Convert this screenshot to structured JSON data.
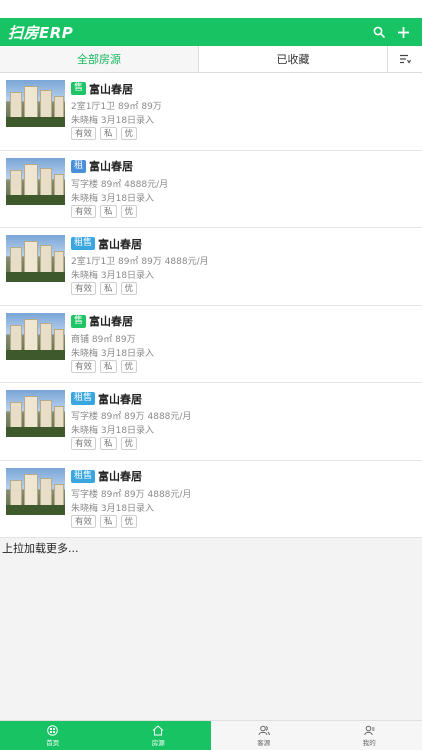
{
  "app": {
    "brand": "扫房ERP"
  },
  "colors": {
    "primary": "#18c364",
    "sale_badge": "#1fc465",
    "rent_badge": "#4a90d9",
    "salerent_badge": "#3aa6e0"
  },
  "tabs": [
    {
      "label": "全部房源",
      "active": true
    },
    {
      "label": "已收藏",
      "active": false
    }
  ],
  "listings": [
    {
      "badge": "售",
      "badge_type": "sale",
      "name": "富山春居",
      "detail": "2室1厅1卫   89㎡   89万",
      "agent": "朱晓梅   3月18日录入",
      "tags": [
        "有效",
        "私",
        "优"
      ]
    },
    {
      "badge": "租",
      "badge_type": "rent",
      "name": "富山春居",
      "detail": "写字楼   89㎡   4888元/月",
      "agent": "朱晓梅   3月18日录入",
      "tags": [
        "有效",
        "私",
        "优"
      ]
    },
    {
      "badge": "租售",
      "badge_type": "salerent",
      "name": "富山春居",
      "detail": "2室1厅1卫   89㎡   89万   4888元/月",
      "agent": "朱晓梅   3月18日录入",
      "tags": [
        "有效",
        "私",
        "优"
      ]
    },
    {
      "badge": "售",
      "badge_type": "sale",
      "name": "富山春居",
      "detail": "商铺   89㎡   89万",
      "agent": "朱晓梅   3月18日录入",
      "tags": [
        "有效",
        "私",
        "优"
      ]
    },
    {
      "badge": "租售",
      "badge_type": "salerent",
      "name": "富山春居",
      "detail": "写字楼   89㎡   89万   4888元/月",
      "agent": "朱晓梅   3月18日录入",
      "tags": [
        "有效",
        "私",
        "优"
      ]
    },
    {
      "badge": "租售",
      "badge_type": "salerent",
      "name": "富山春居",
      "detail": "写字楼   89㎡   89万   4888元/月",
      "agent": "朱晓梅   3月18日录入",
      "tags": [
        "有效",
        "私",
        "优"
      ]
    }
  ],
  "load_more": "上拉加载更多...",
  "bottom_nav": [
    {
      "label": "首页",
      "icon": "home-grid-icon",
      "active": false
    },
    {
      "label": "房源",
      "icon": "house-icon",
      "active": true
    },
    {
      "label": "客源",
      "icon": "customers-icon",
      "active": false
    },
    {
      "label": "我的",
      "icon": "profile-icon",
      "active": false
    }
  ]
}
